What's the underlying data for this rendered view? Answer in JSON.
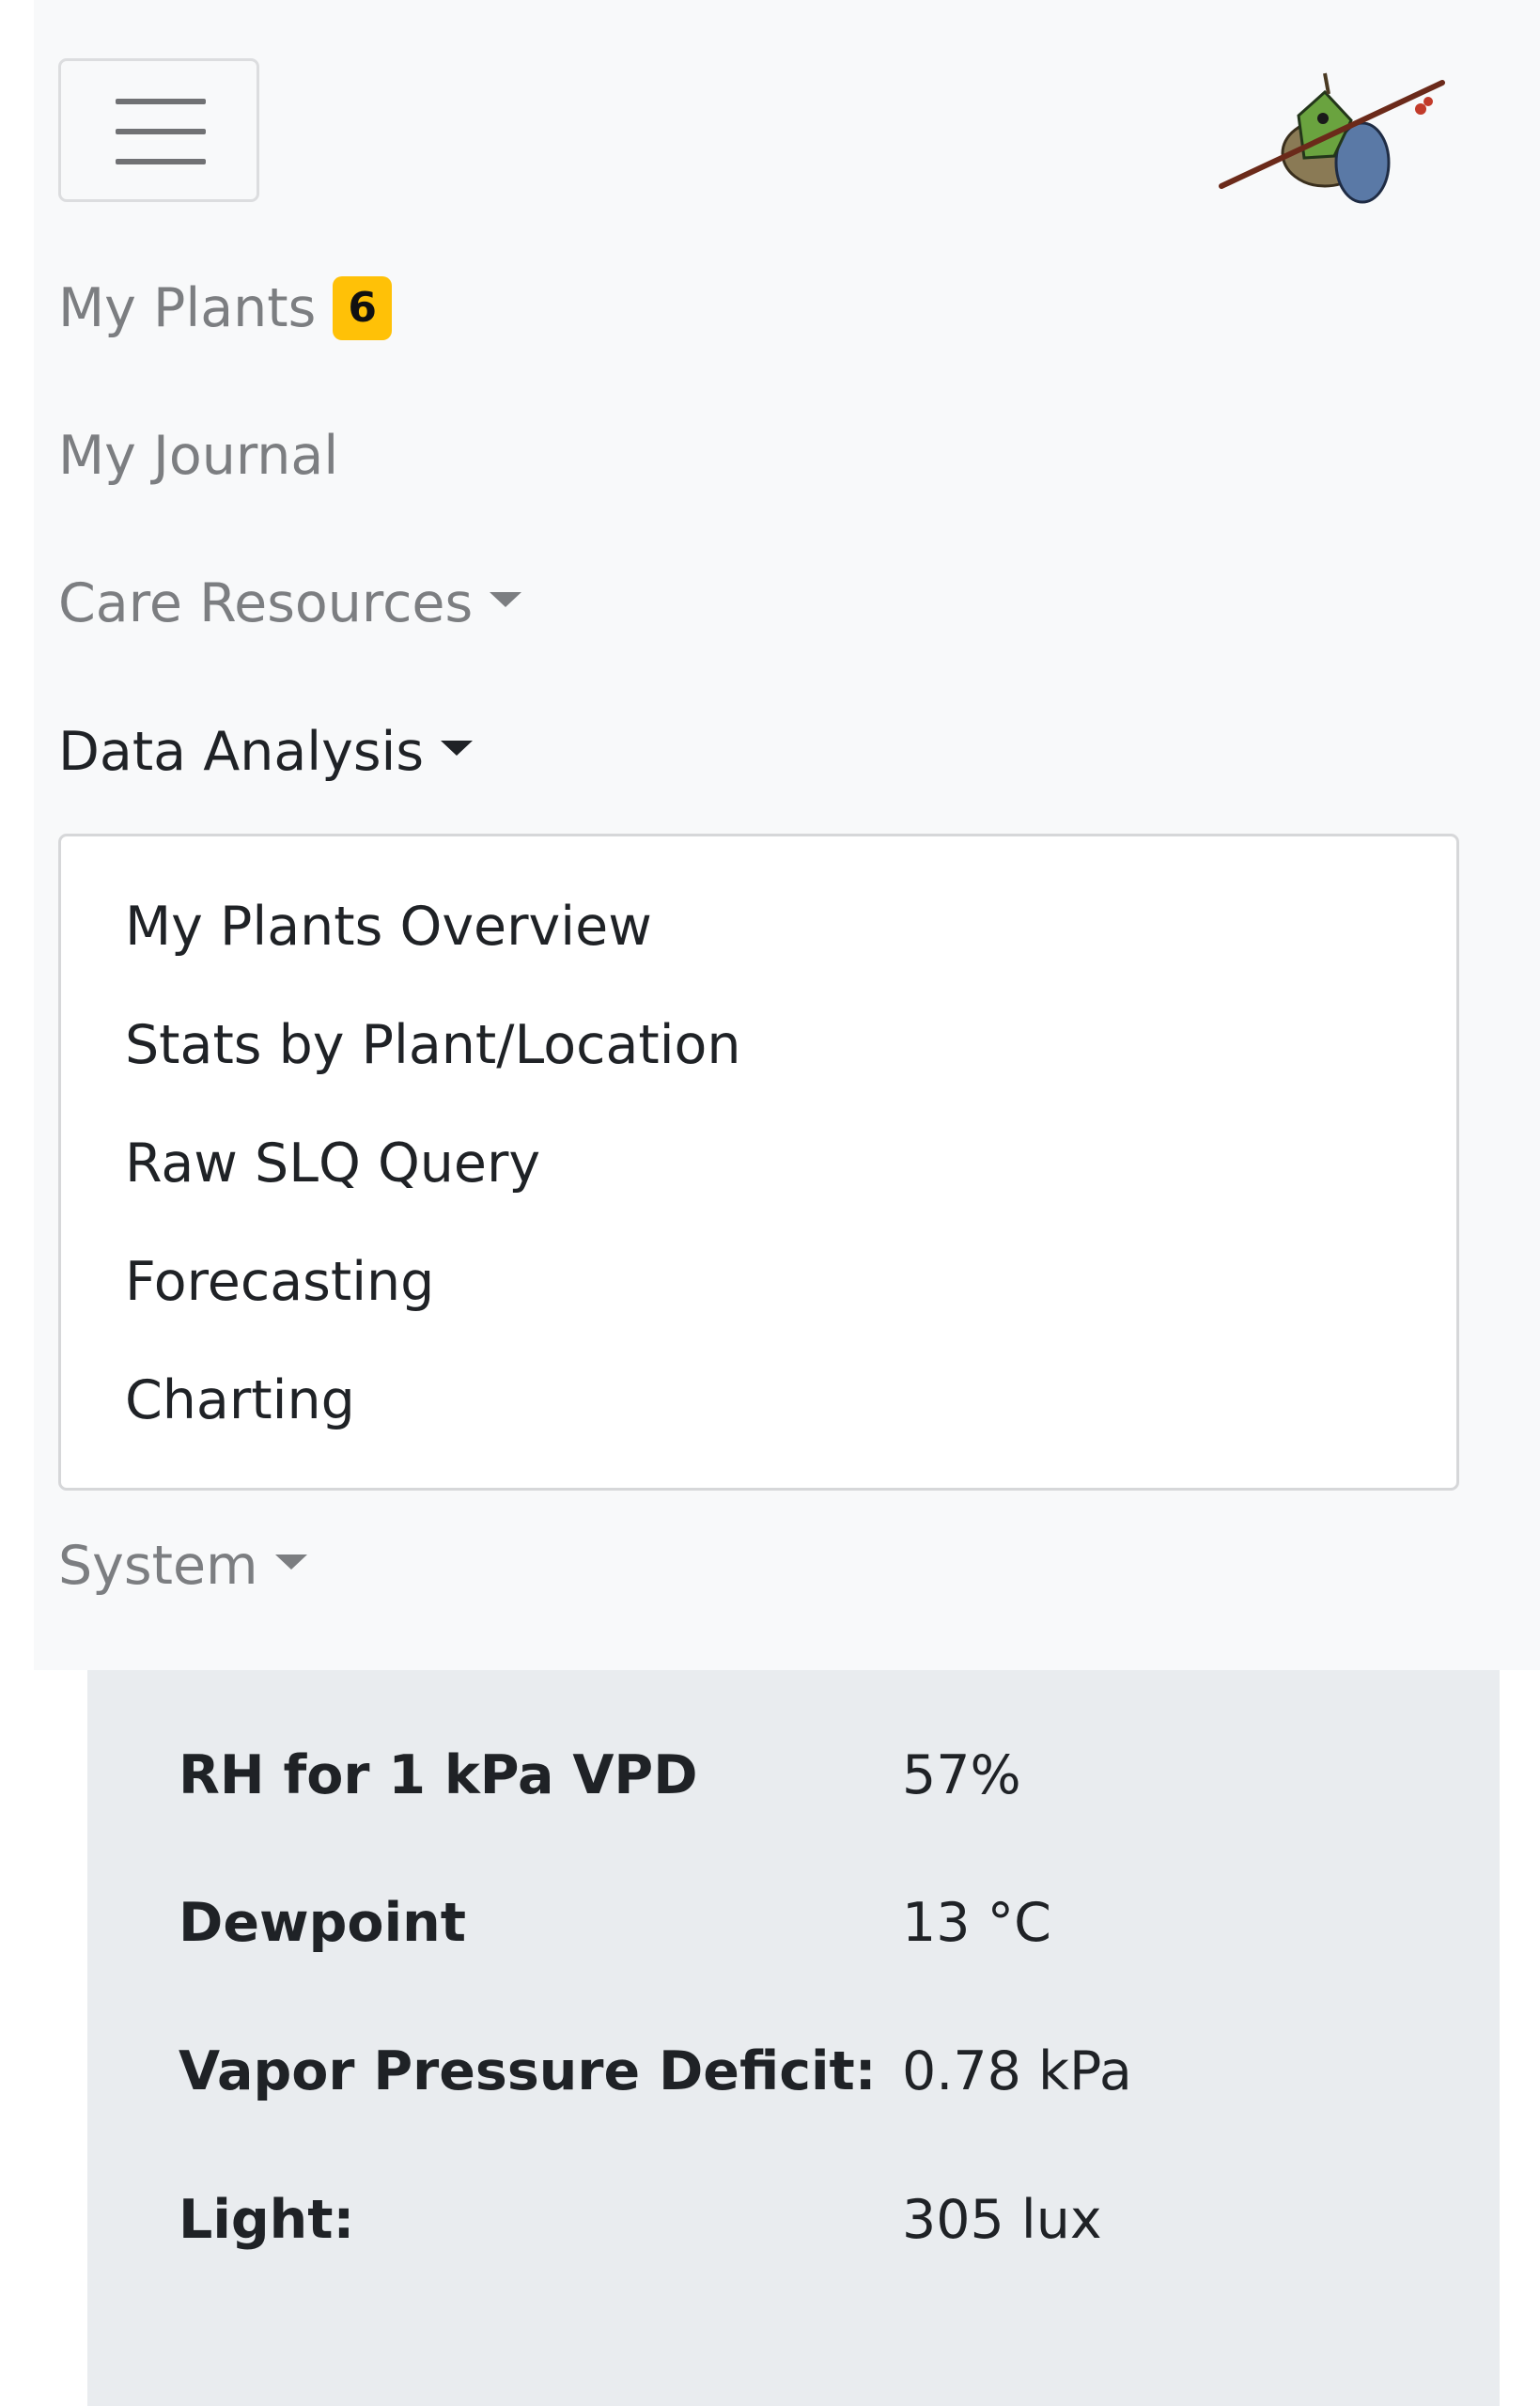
{
  "navbar": {
    "toggler_label": "Toggle navigation",
    "links": {
      "my_plants": "My Plants",
      "my_plants_badge": "6",
      "my_journal": "My Journal",
      "care_resources": "Care Resources",
      "data_analysis": "Data Analysis",
      "system": "System"
    },
    "dropdown_items": [
      "My Plants Overview",
      "Stats by Plant/Location",
      "Raw SLQ Query",
      "Forecasting",
      "Charting"
    ]
  },
  "stats": [
    {
      "label": "RH for 1 kPa VPD",
      "value": "57%"
    },
    {
      "label": "Dewpoint",
      "value": "13 °C"
    },
    {
      "label": "Vapor Pressure Deficit:",
      "value": "0.78 kPa"
    },
    {
      "label": "Light:",
      "value": "305 lux"
    }
  ],
  "colors": {
    "navbar_bg": "#f8f9fa",
    "badge": "#ffc107",
    "panel_bg": "#e9ecef",
    "muted_link": "#7c7e81",
    "active_link": "#1f2226"
  }
}
